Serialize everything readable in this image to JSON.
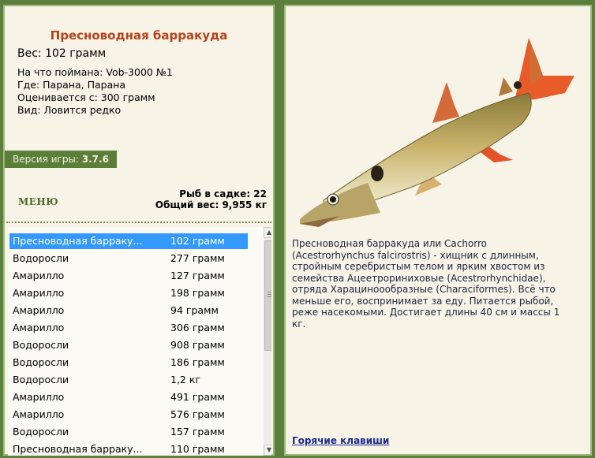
{
  "fish": {
    "title": "Пресноводная барракуда",
    "weight": "Вес: 102 грамм",
    "caught_on": "На что поймана: Vob-3000 №1",
    "where": "Где: Парана, Парана",
    "valued_from": "Оценивается с: 300 грамм",
    "kind": "Вид: Ловится редко"
  },
  "version": {
    "label": "Версия игры: ",
    "value": "3.7.6"
  },
  "menu": {
    "label": "МЕНЮ"
  },
  "stats": {
    "fish_count": "Рыб в садке: 22",
    "total_weight": "Общий вес: 9,955 кг"
  },
  "catch_list": [
    {
      "name": "Пресноводная барраку...",
      "weight": "102 грамм",
      "selected": true
    },
    {
      "name": "Водоросли",
      "weight": "277 грамм"
    },
    {
      "name": "Амарилло",
      "weight": "127 грамм"
    },
    {
      "name": "Амарилло",
      "weight": "198 грамм"
    },
    {
      "name": "Амарилло",
      "weight": "94 грамм"
    },
    {
      "name": "Амарилло",
      "weight": "306 грамм"
    },
    {
      "name": "Водоросли",
      "weight": "908 грамм"
    },
    {
      "name": "Водоросли",
      "weight": "186 грамм"
    },
    {
      "name": "Водоросли",
      "weight": "1,2 кг"
    },
    {
      "name": "Амарилло",
      "weight": "491 грамм"
    },
    {
      "name": "Амарилло",
      "weight": "576 грамм"
    },
    {
      "name": "Водоросли",
      "weight": "157 грамм"
    },
    {
      "name": "Пресноводная барраку...",
      "weight": "110 грамм"
    }
  ],
  "description": "Пресноводная барракуда или Cachorro (Acestrorhynchus falcirostris) - хищник с длинным, стройным серебристым телом и ярким хвостом из семейства Ацеетрориниховые (Acestrorhynchidae), отряда Харациноообразные (Characiformes). Всё что меньше его, воспринимает за еду. Питается рыбой, реже насекомыми. Достигает длины 40 см и массы 1 кг.",
  "hotkeys": {
    "label": "Горячие клавиши"
  },
  "colors": {
    "background": "#5d7f3e",
    "panel": "#f7f3e7",
    "title": "#b5431a",
    "selection": "#3399ff",
    "version_bar": "#5b7f38"
  }
}
